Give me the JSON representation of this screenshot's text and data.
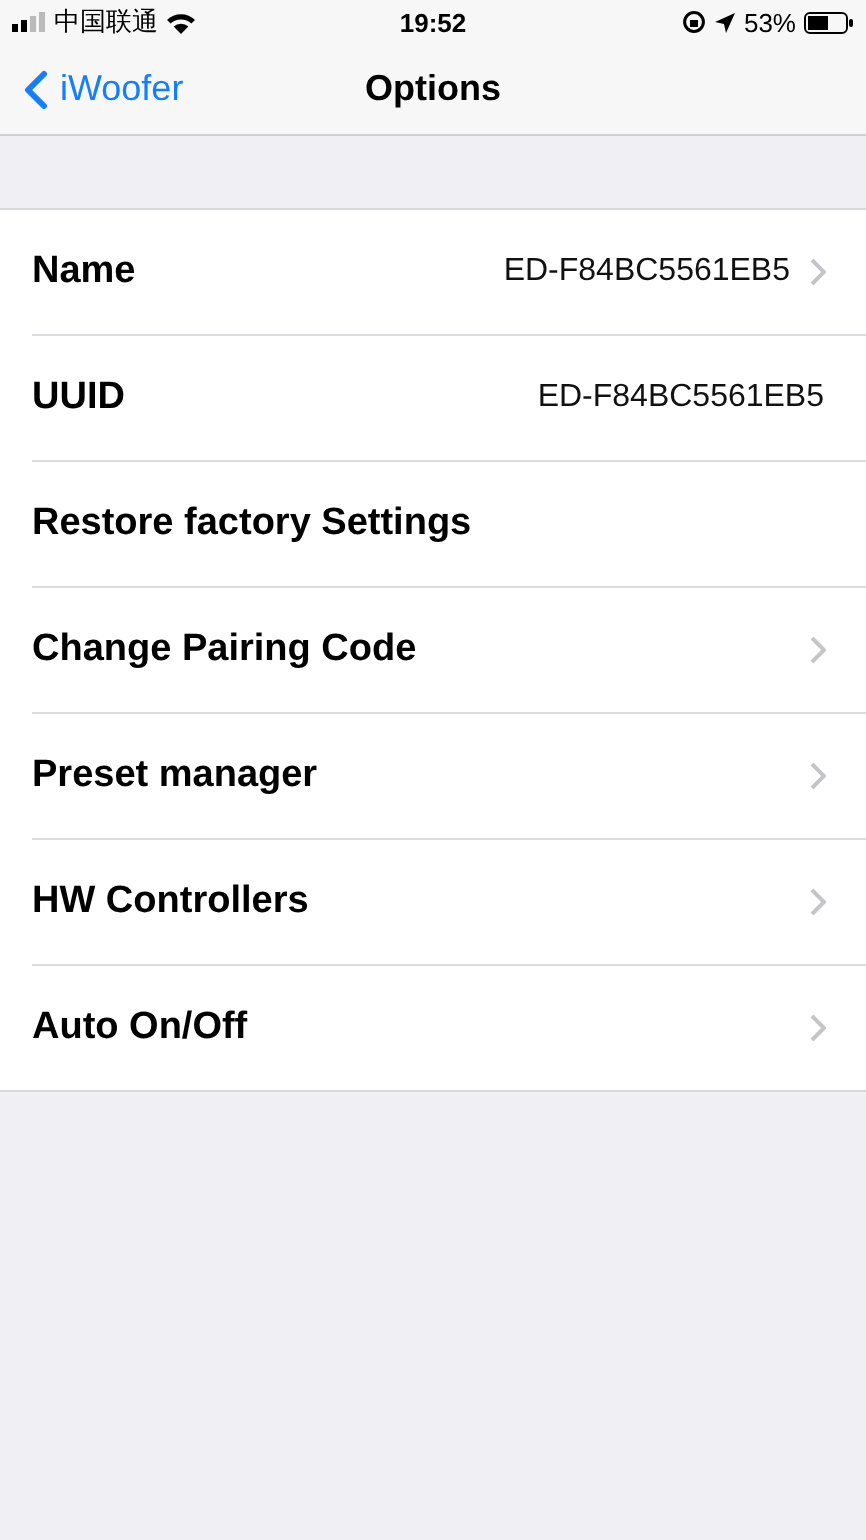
{
  "status_bar": {
    "carrier": "中国联通",
    "time": "19:52",
    "battery": "53%"
  },
  "nav": {
    "back": "iWoofer",
    "title": "Options"
  },
  "rows": [
    {
      "label": "Name",
      "value": "ED-F84BC5561EB5",
      "chevron": true
    },
    {
      "label": "UUID",
      "value": "ED-F84BC5561EB5",
      "chevron": false
    },
    {
      "label": "Restore factory Settings",
      "chevron": false
    },
    {
      "label": "Change Pairing Code",
      "chevron": true
    },
    {
      "label": "Preset manager",
      "chevron": true
    },
    {
      "label": "HW Controllers",
      "chevron": true
    },
    {
      "label": "Auto On/Off",
      "chevron": true
    }
  ]
}
